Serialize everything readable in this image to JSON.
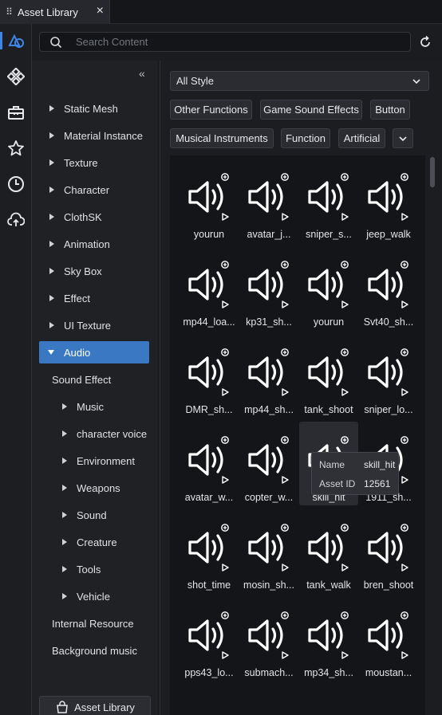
{
  "tab": {
    "title": "Asset Library",
    "close": "×"
  },
  "rail": {
    "items": [
      {
        "icon": "shapes-icon",
        "active": true
      },
      {
        "icon": "components-icon",
        "active": false
      },
      {
        "icon": "toolbox-icon",
        "active": false
      },
      {
        "icon": "star-icon",
        "active": false
      },
      {
        "icon": "clock-icon",
        "active": false
      },
      {
        "icon": "cloud-upload-icon",
        "active": false
      }
    ]
  },
  "search": {
    "placeholder": "Search Content"
  },
  "tree": {
    "items": [
      {
        "label": "Static Mesh",
        "level": 0,
        "arrow": true
      },
      {
        "label": "Material Instance",
        "level": 0,
        "arrow": true
      },
      {
        "label": "Texture",
        "level": 0,
        "arrow": true
      },
      {
        "label": "Character",
        "level": 0,
        "arrow": true
      },
      {
        "label": "ClothSK",
        "level": 0,
        "arrow": true
      },
      {
        "label": "Animation",
        "level": 0,
        "arrow": true
      },
      {
        "label": "Sky Box",
        "level": 0,
        "arrow": true
      },
      {
        "label": "Effect",
        "level": 0,
        "arrow": true
      },
      {
        "label": "UI Texture",
        "level": 0,
        "arrow": true
      },
      {
        "label": "Audio",
        "level": 0,
        "arrow": true,
        "selected": true
      },
      {
        "label": "Sound Effect",
        "level": 1,
        "arrow": false
      },
      {
        "label": "Music",
        "level": 2,
        "arrow": true
      },
      {
        "label": "character voice",
        "level": 2,
        "arrow": true
      },
      {
        "label": "Environment",
        "level": 2,
        "arrow": true
      },
      {
        "label": "Weapons",
        "level": 2,
        "arrow": true
      },
      {
        "label": "Sound",
        "level": 2,
        "arrow": true
      },
      {
        "label": "Creature",
        "level": 2,
        "arrow": true
      },
      {
        "label": "Tools",
        "level": 2,
        "arrow": true
      },
      {
        "label": "Vehicle",
        "level": 2,
        "arrow": true
      },
      {
        "label": "Internal Resource",
        "level": 1,
        "arrow": false
      },
      {
        "label": "Background music",
        "level": 1,
        "arrow": false
      }
    ],
    "library_button": "Asset Library"
  },
  "filter": {
    "style_selected": "All Style",
    "tags": [
      "Other Functions",
      "Game Sound Effects",
      "Button",
      "Musical Instruments",
      "Function",
      "Artificial"
    ]
  },
  "assets": [
    "yourun",
    "avatar_j...",
    "sniper_s...",
    "jeep_walk",
    "mp44_loa...",
    "kp31_sh...",
    "yourun",
    "Svt40_sh...",
    "DMR_sh...",
    "mp44_sh...",
    "tank_shoot",
    "sniper_lo...",
    "avatar_w...",
    "copter_w...",
    "skill_hit",
    "1911_sh...",
    "shot_time",
    "mosin_sh...",
    "tank_walk",
    "bren_shoot",
    "pps43_lo...",
    "submach...",
    "mp34_sh...",
    "moustan..."
  ],
  "tooltip": {
    "name_label": "Name",
    "name_value": "skill_hit",
    "id_label": "Asset ID",
    "id_value": "12561"
  },
  "colors": {
    "accent": "#3a78c4",
    "background": "#1b1c1f"
  }
}
